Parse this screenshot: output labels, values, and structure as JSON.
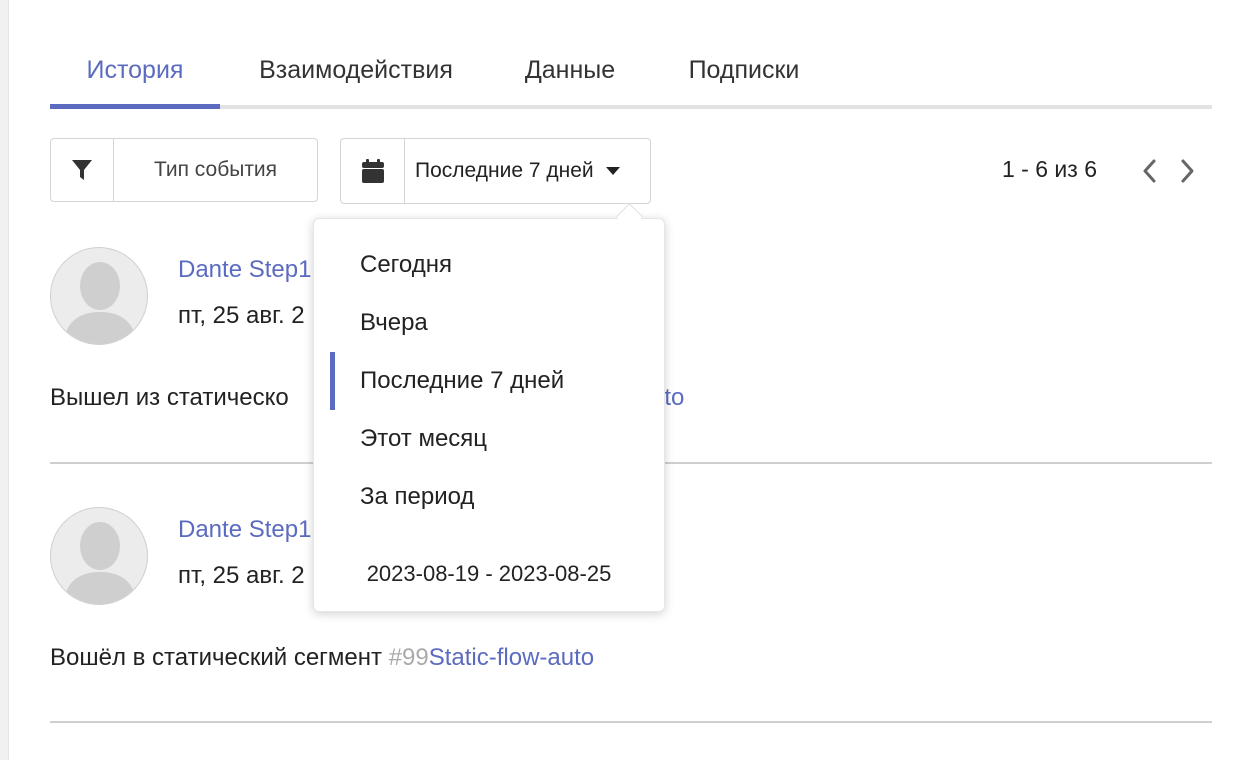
{
  "tabs": [
    {
      "label": "История",
      "active": true
    },
    {
      "label": "Взаимодействия",
      "active": false
    },
    {
      "label": "Данные",
      "active": false
    },
    {
      "label": "Подписки",
      "active": false
    }
  ],
  "toolbar": {
    "filter_label": "Тип события",
    "filter_icon": "filter-icon",
    "date_label": "Последние 7 дней",
    "date_icon": "calendar-icon",
    "pagination_text": "1 - 6 из 6"
  },
  "events": [
    {
      "name": "Dante Step1",
      "date": "пт, 25 авг. 2",
      "text_prefix": "Вышел из статическо",
      "link_tail": "uto"
    },
    {
      "name": "Dante Step1",
      "date": "пт, 25 авг. 2",
      "text_prefix": "Вошёл в статический сегмент",
      "segment_id": "#99",
      "segment_name": "Static-flow-auto"
    }
  ],
  "dropdown": {
    "items": [
      {
        "label": "Сегодня",
        "selected": false
      },
      {
        "label": "Вчера",
        "selected": false
      },
      {
        "label": "Последние 7 дней",
        "selected": true
      },
      {
        "label": "Этот месяц",
        "selected": false
      },
      {
        "label": "За период",
        "selected": false
      }
    ],
    "range": "2023-08-19 - 2023-08-25"
  },
  "colors": {
    "accent": "#5b6bbf",
    "border": "#d4d4d4",
    "muted": "#aaaaaa"
  }
}
